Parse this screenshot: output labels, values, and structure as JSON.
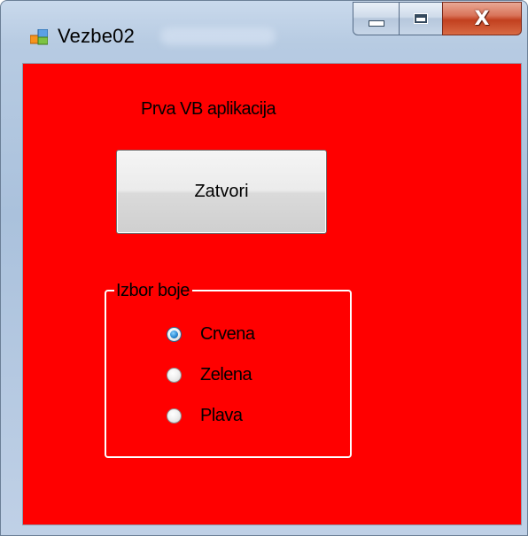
{
  "window": {
    "title": "Vezbe02",
    "controls": {
      "minimize_icon": "minimize-icon",
      "maximize_icon": "maximize-icon",
      "close_glyph": "X"
    }
  },
  "form": {
    "background_color": "#ff0000",
    "heading": "Prva VB aplikacija",
    "close_button_label": "Zatvori",
    "color_group": {
      "legend": "Izbor boje",
      "options": [
        {
          "label": "Crvena",
          "checked": true
        },
        {
          "label": "Zelena",
          "checked": false
        },
        {
          "label": "Plava",
          "checked": false
        }
      ]
    }
  }
}
